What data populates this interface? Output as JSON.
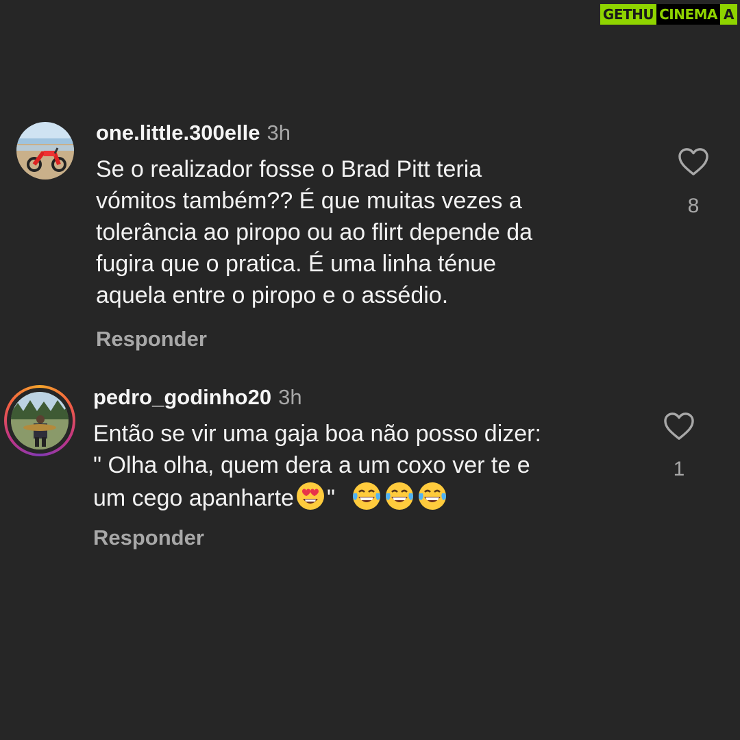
{
  "watermark": {
    "part1": "GETHU",
    "part2": "CINEMA",
    "part3": "A"
  },
  "comments": [
    {
      "username": "one.little.300elle",
      "time": "3h",
      "text": "Se o realizador fosse o Brad Pitt teria\nvómitos também?? É que muitas vezes a\ntolerância ao piropo ou ao flirt depende da\nfugira que o pratica. É uma linha ténue\naquela entre o piropo e o assédio.",
      "reply_label": "Responder",
      "likes": "8",
      "avatar_icon": "motorcycle-beach-photo",
      "has_story_ring": false
    },
    {
      "username": "pedro_godinho20",
      "time": "3h",
      "text_line1": "Então se vir uma gaja boa não posso dizer:",
      "text_line2": "\" Olha olha, quem dera a um coxo ver te e",
      "text_line3_prefix": "um cego apanharte",
      "text_line3_mid": "\" ",
      "emojis": [
        "heart-eyes-emoji",
        "tears-of-joy-emoji",
        "tears-of-joy-emoji",
        "tears-of-joy-emoji"
      ],
      "reply_label": "Responder",
      "likes": "1",
      "avatar_icon": "fisherman-photo",
      "has_story_ring": true
    }
  ],
  "colors": {
    "background": "#262626",
    "primary_text": "#f2f2f2",
    "secondary_text": "#a8a8a8",
    "story_ring": [
      "#f4a52b",
      "#f56040",
      "#c13584",
      "#833ab4"
    ]
  }
}
